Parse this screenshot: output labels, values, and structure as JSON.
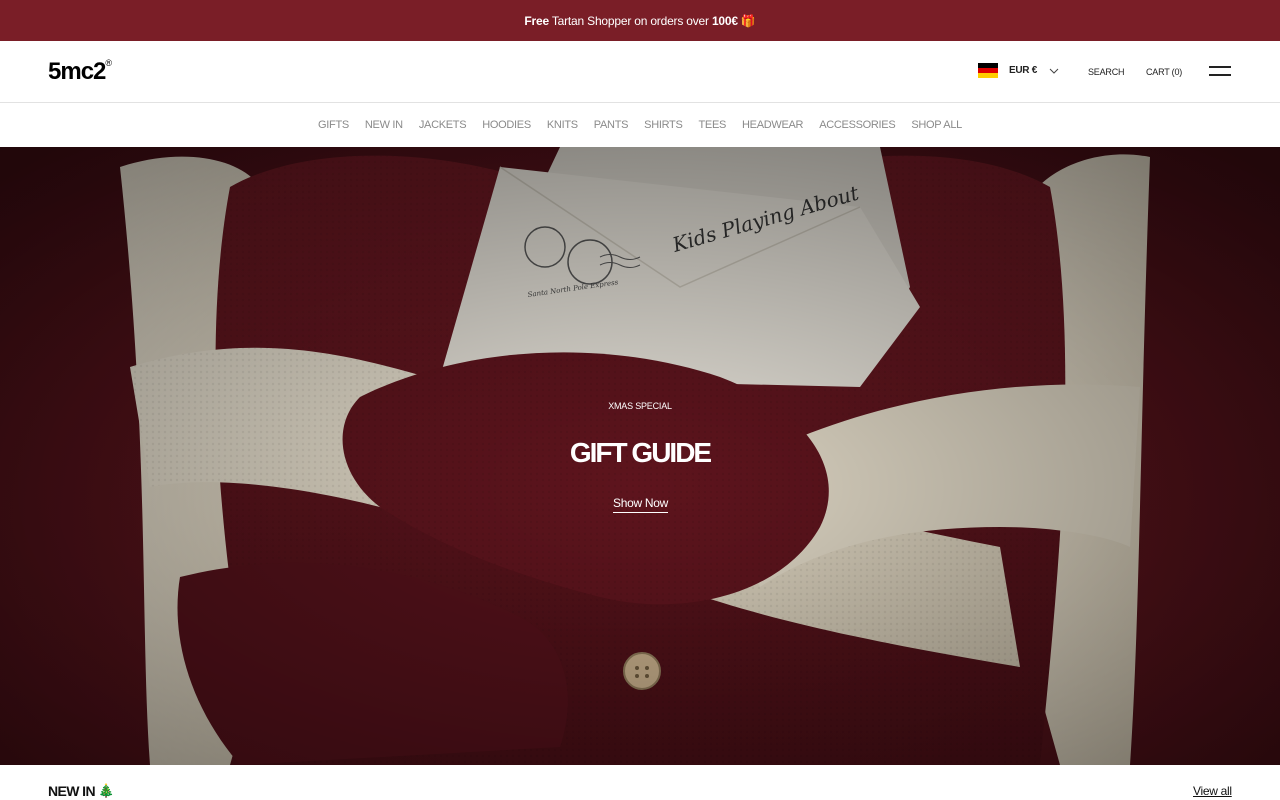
{
  "announcement": {
    "free": "Free",
    "text": " Tartan Shopper on orders over ",
    "amount": "100€",
    "gift_icon": "🎁"
  },
  "header": {
    "logo": "5mc2",
    "logo_mark": "®",
    "currency": "EUR €",
    "flag_colors": [
      "#000000",
      "#dd0000",
      "#ffce00"
    ],
    "search": "SEARCH",
    "cart": "CART (0)"
  },
  "nav": {
    "items": [
      "GIFTS",
      "NEW IN",
      "JACKETS",
      "HOODIES",
      "KNITS",
      "PANTS",
      "SHIRTS",
      "TEES",
      "HEADWEAR",
      "ACCESSORIES",
      "SHOP ALL"
    ]
  },
  "hero": {
    "eyebrow": "XMAS SPECIAL",
    "title": "GIFT GUIDE",
    "cta": "Show Now",
    "envelope_text": "Kids Playing About",
    "stamp_text": "Santa North Pole Express"
  },
  "section": {
    "title": "NEW IN",
    "emoji": "🎄",
    "view_all": "View all"
  },
  "colors": {
    "announcement_bg": "#7a1e27",
    "hero_bg": "#5a141c",
    "nav_text": "#8a8a8a"
  }
}
